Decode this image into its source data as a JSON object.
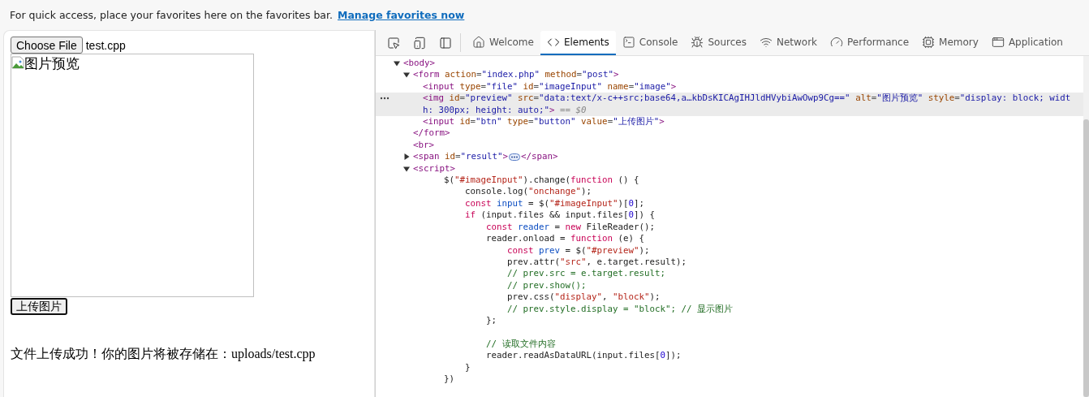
{
  "favorites_bar": {
    "message": "For quick access, place your favorites here on the favorites bar.",
    "link": "Manage favorites now"
  },
  "page": {
    "file_button": "Choose File",
    "file_name": "test.cpp",
    "image_alt": "图片预览",
    "upload_button": "上传图片",
    "result": "文件上传成功！你的图片将被存储在：uploads/test.cpp"
  },
  "devtools": {
    "tabs": [
      {
        "label": "Welcome",
        "selected": false
      },
      {
        "label": "Elements",
        "selected": true
      },
      {
        "label": "Console",
        "selected": false
      },
      {
        "label": "Sources",
        "selected": false
      },
      {
        "label": "Network",
        "selected": false
      },
      {
        "label": "Performance",
        "selected": false
      },
      {
        "label": "Memory",
        "selected": false
      },
      {
        "label": "Application",
        "selected": false
      }
    ],
    "tree": [
      {
        "kind": "element",
        "selected": false,
        "expanded": true,
        "tokens": [
          {
            "kind": "tag",
            "text": "<body>"
          }
        ],
        "children": [
          {
            "kind": "element",
            "selected": false,
            "expanded": true,
            "tokens": [
              {
                "kind": "tag",
                "text": "<form"
              },
              {
                "kind": "attr",
                "text": " action"
              },
              {
                "kind": "punct",
                "text": "="
              },
              {
                "kind": "value",
                "text": "\"index.php\""
              },
              {
                "kind": "attr",
                "text": " method"
              },
              {
                "kind": "punct",
                "text": "="
              },
              {
                "kind": "value",
                "text": "\"post\""
              },
              {
                "kind": "tag",
                "text": ">"
              }
            ],
            "close": [
              {
                "kind": "tag",
                "text": "</form>"
              }
            ],
            "children": [
              {
                "kind": "element",
                "selected": false,
                "tokens": [
                  {
                    "kind": "tag",
                    "text": "<input"
                  },
                  {
                    "kind": "attr",
                    "text": " type"
                  },
                  {
                    "kind": "punct",
                    "text": "="
                  },
                  {
                    "kind": "value",
                    "text": "\"file\""
                  },
                  {
                    "kind": "attr",
                    "text": " id"
                  },
                  {
                    "kind": "punct",
                    "text": "="
                  },
                  {
                    "kind": "value",
                    "text": "\"imageInput\""
                  },
                  {
                    "kind": "attr",
                    "text": " name"
                  },
                  {
                    "kind": "punct",
                    "text": "="
                  },
                  {
                    "kind": "value",
                    "text": "\"image\""
                  },
                  {
                    "kind": "tag",
                    "text": ">"
                  }
                ]
              },
              {
                "kind": "element",
                "selected": true,
                "tokens": [
                  {
                    "kind": "tag",
                    "text": "<img"
                  },
                  {
                    "kind": "attr",
                    "text": " id"
                  },
                  {
                    "kind": "punct",
                    "text": "="
                  },
                  {
                    "kind": "value",
                    "text": "\"preview\""
                  },
                  {
                    "kind": "attr",
                    "text": " src"
                  },
                  {
                    "kind": "punct",
                    "text": "="
                  },
                  {
                    "kind": "value",
                    "text": "\"data:text/x-c++src;base64,a…kbDsKICAgIHJldHVybiAwOwp9Cg==\""
                  },
                  {
                    "kind": "attr",
                    "text": " alt"
                  },
                  {
                    "kind": "punct",
                    "text": "="
                  },
                  {
                    "kind": "value",
                    "text": "\"图片预览\""
                  },
                  {
                    "kind": "attr",
                    "text": " style"
                  },
                  {
                    "kind": "punct",
                    "text": "="
                  },
                  {
                    "kind": "value",
                    "text": "\"display: block; width: 300px; height: auto;\""
                  },
                  {
                    "kind": "tag",
                    "text": ">"
                  },
                  {
                    "kind": "dim",
                    "text": " == $0"
                  }
                ]
              },
              {
                "kind": "element",
                "selected": false,
                "tokens": [
                  {
                    "kind": "tag",
                    "text": "<input"
                  },
                  {
                    "kind": "attr",
                    "text": " id"
                  },
                  {
                    "kind": "punct",
                    "text": "="
                  },
                  {
                    "kind": "value",
                    "text": "\"btn\""
                  },
                  {
                    "kind": "attr",
                    "text": " type"
                  },
                  {
                    "kind": "punct",
                    "text": "="
                  },
                  {
                    "kind": "value",
                    "text": "\"button\""
                  },
                  {
                    "kind": "attr",
                    "text": " value"
                  },
                  {
                    "kind": "punct",
                    "text": "="
                  },
                  {
                    "kind": "value",
                    "text": "\"上传图片\""
                  },
                  {
                    "kind": "tag",
                    "text": ">"
                  }
                ]
              }
            ]
          },
          {
            "kind": "element",
            "selected": false,
            "tokens": [
              {
                "kind": "tag",
                "text": "<br>"
              }
            ]
          },
          {
            "kind": "element",
            "selected": false,
            "expanded": false,
            "tokens": [
              {
                "kind": "tag",
                "text": "<span"
              },
              {
                "kind": "attr",
                "text": " id"
              },
              {
                "kind": "punct",
                "text": "="
              },
              {
                "kind": "value",
                "text": "\"result\""
              },
              {
                "kind": "tag",
                "text": ">"
              },
              {
                "kind": "ellipsis"
              },
              {
                "kind": "tag",
                "text": "</span>"
              }
            ]
          },
          {
            "kind": "element",
            "selected": false,
            "expanded": true,
            "tokens": [
              {
                "kind": "tag",
                "text": "<script>"
              }
            ],
            "children": [
              {
                "kind": "code",
                "selected": false,
                "tokens": [
                  {
                    "kind": "plain",
                    "text": "    $("
                  },
                  {
                    "kind": "string",
                    "text": "\"#imageInput\""
                  },
                  {
                    "kind": "plain",
                    "text": ").change("
                  },
                  {
                    "kind": "keyword",
                    "text": "function"
                  },
                  {
                    "kind": "plain",
                    "text": " () {"
                  }
                ]
              },
              {
                "kind": "code",
                "selected": false,
                "tokens": [
                  {
                    "kind": "plain",
                    "text": "        console.log("
                  },
                  {
                    "kind": "string",
                    "text": "\"onchange\""
                  },
                  {
                    "kind": "plain",
                    "text": ");"
                  }
                ]
              },
              {
                "kind": "code",
                "selected": false,
                "tokens": [
                  {
                    "kind": "keyword",
                    "text": "        const"
                  },
                  {
                    "kind": "variable",
                    "text": " input"
                  },
                  {
                    "kind": "plain",
                    "text": " = $("
                  },
                  {
                    "kind": "string",
                    "text": "\"#imageInput\""
                  },
                  {
                    "kind": "plain",
                    "text": ")["
                  },
                  {
                    "kind": "number",
                    "text": "0"
                  },
                  {
                    "kind": "plain",
                    "text": "];"
                  }
                ]
              },
              {
                "kind": "code",
                "selected": false,
                "tokens": [
                  {
                    "kind": "keyword",
                    "text": "        if"
                  },
                  {
                    "kind": "plain",
                    "text": " (input.files && input.files["
                  },
                  {
                    "kind": "number",
                    "text": "0"
                  },
                  {
                    "kind": "plain",
                    "text": "]) {"
                  }
                ]
              },
              {
                "kind": "code",
                "selected": false,
                "tokens": [
                  {
                    "kind": "keyword",
                    "text": "            const"
                  },
                  {
                    "kind": "variable",
                    "text": " reader"
                  },
                  {
                    "kind": "plain",
                    "text": " = "
                  },
                  {
                    "kind": "keyword",
                    "text": "new"
                  },
                  {
                    "kind": "plain",
                    "text": " FileReader();"
                  }
                ]
              },
              {
                "kind": "code",
                "selected": false,
                "tokens": [
                  {
                    "kind": "plain",
                    "text": "            reader.onload = "
                  },
                  {
                    "kind": "keyword",
                    "text": "function"
                  },
                  {
                    "kind": "plain",
                    "text": " (e) {"
                  }
                ]
              },
              {
                "kind": "code",
                "selected": false,
                "tokens": [
                  {
                    "kind": "keyword",
                    "text": "                const"
                  },
                  {
                    "kind": "variable",
                    "text": " prev"
                  },
                  {
                    "kind": "plain",
                    "text": " = $("
                  },
                  {
                    "kind": "string",
                    "text": "\"#preview\""
                  },
                  {
                    "kind": "plain",
                    "text": ");"
                  }
                ]
              },
              {
                "kind": "code",
                "selected": false,
                "tokens": [
                  {
                    "kind": "plain",
                    "text": "                prev.attr("
                  },
                  {
                    "kind": "string",
                    "text": "\"src\""
                  },
                  {
                    "kind": "plain",
                    "text": ", e.target.result);"
                  }
                ]
              },
              {
                "kind": "code",
                "selected": false,
                "tokens": [
                  {
                    "kind": "comment",
                    "text": "                // prev.src = e.target.result;"
                  }
                ]
              },
              {
                "kind": "code",
                "selected": false,
                "tokens": [
                  {
                    "kind": "comment",
                    "text": "                // prev.show();"
                  }
                ]
              },
              {
                "kind": "code",
                "selected": false,
                "tokens": [
                  {
                    "kind": "plain",
                    "text": "                prev.css("
                  },
                  {
                    "kind": "string",
                    "text": "\"display\""
                  },
                  {
                    "kind": "plain",
                    "text": ", "
                  },
                  {
                    "kind": "string",
                    "text": "\"block\""
                  },
                  {
                    "kind": "plain",
                    "text": ");"
                  }
                ]
              },
              {
                "kind": "code",
                "selected": false,
                "tokens": [
                  {
                    "kind": "comment",
                    "text": "                // prev.style.display = \"block\"; // 显示图片"
                  }
                ]
              },
              {
                "kind": "code",
                "selected": false,
                "tokens": [
                  {
                    "kind": "plain",
                    "text": "            };"
                  }
                ]
              },
              {
                "kind": "blank",
                "selected": false
              },
              {
                "kind": "code",
                "selected": false,
                "tokens": [
                  {
                    "kind": "comment",
                    "text": "            // 读取文件内容"
                  }
                ]
              },
              {
                "kind": "code",
                "selected": false,
                "tokens": [
                  {
                    "kind": "plain",
                    "text": "            reader.readAsDataURL(input.files["
                  },
                  {
                    "kind": "number",
                    "text": "0"
                  },
                  {
                    "kind": "plain",
                    "text": "]);"
                  }
                ]
              },
              {
                "kind": "code",
                "selected": false,
                "tokens": [
                  {
                    "kind": "plain",
                    "text": "        }"
                  }
                ]
              },
              {
                "kind": "code",
                "selected": false,
                "tokens": [
                  {
                    "kind": "plain",
                    "text": "    })"
                  }
                ]
              }
            ]
          }
        ]
      }
    ]
  }
}
